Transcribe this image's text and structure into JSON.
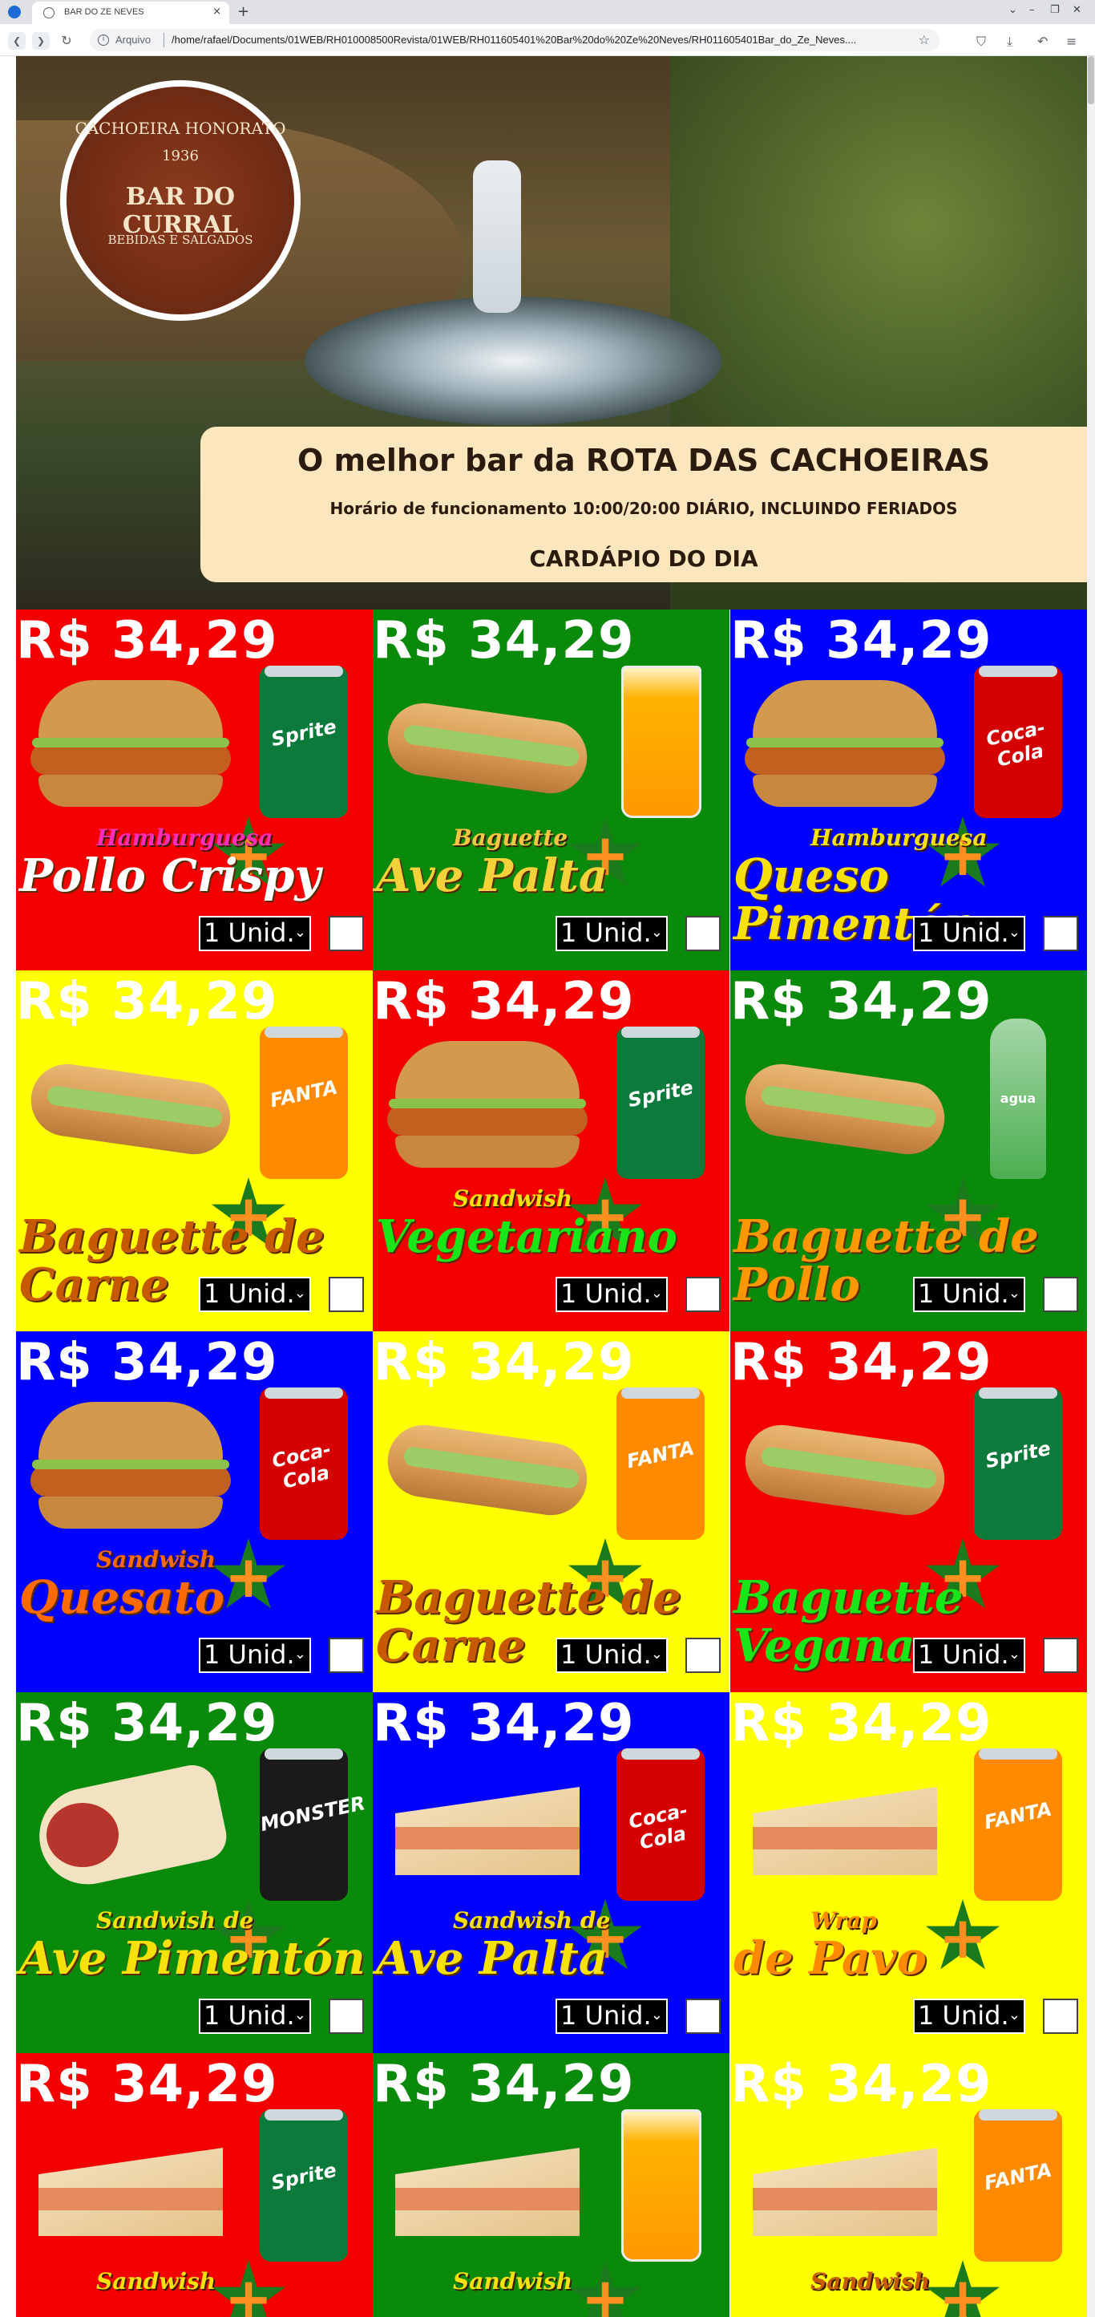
{
  "browser": {
    "tab_title": "BAR DO ZE NEVES",
    "tab_close": "×",
    "new_tab": "+",
    "scheme_label": "Arquivo",
    "url": "/home/rafael/Documents/01WEB/RH010008500Revista/01WEB/RH011605401%20Bar%20do%20Ze%20Neves/RH011605401Bar_do_Ze_Neves....",
    "window_min": "–",
    "window_max": "❐",
    "window_close": "✕"
  },
  "logo": {
    "line1": "CACHOEIRA HONORATO",
    "line2": "1936",
    "line3": "BAR DO CURRAL",
    "line4": "BEBIDAS E SALGADOS"
  },
  "banner": {
    "title": "O melhor bar da ROTA DAS CACHOEIRAS",
    "hours": "Horário de funcionamento 10:00/20:00 DIÁRIO, INCLUINDO FERIADOS",
    "menu_heading": "CARDÁPIO DO DIA"
  },
  "menu": {
    "price": "R$ 34,29",
    "plus_sign": "+",
    "qty_label": "1 Unid.",
    "qty_caret": "⌄",
    "items": [
      {
        "bg": "#f50000",
        "food": "burger",
        "drink": "can",
        "drink_color": "#0b7a3a",
        "drink_brand": "Sprite",
        "name1": "Hamburguesa",
        "name1_color": "#ff2db8",
        "name2": "Pollo Crispy",
        "name2_color": "#ffffff"
      },
      {
        "bg": "#0a8a0a",
        "food": "baguette",
        "drink": "glass",
        "drink_color": "#ff9800",
        "drink_brand": "",
        "name1": "Baguette",
        "name1_color": "#f7c744",
        "name2": "Ave Palta",
        "name2_color": "#f6d23a"
      },
      {
        "bg": "#0000ff",
        "food": "burger",
        "drink": "can",
        "drink_color": "#d50000",
        "drink_brand": "Coca-Cola",
        "name1": "Hamburguesa",
        "name1_color": "#f6e10a",
        "name2": "Queso Pimentón",
        "name2_color": "#f6e10a"
      },
      {
        "bg": "#ffff00",
        "food": "baguette",
        "drink": "can",
        "drink_color": "#ff8a00",
        "drink_brand": "FANTA",
        "name1": "",
        "name1_color": "#c75a00",
        "name2": "Baguette de Carne",
        "name2_color": "#c75a00"
      },
      {
        "bg": "#f50000",
        "food": "burger",
        "drink": "can",
        "drink_color": "#0b7a3a",
        "drink_brand": "Sprite",
        "name1": "Sandwish",
        "name1_color": "#f6e10a",
        "name2": "Vegetariano",
        "name2_color": "#19e619"
      },
      {
        "bg": "#0a8a0a",
        "food": "baguette",
        "drink": "bottle",
        "drink_color": "#4caf50",
        "drink_brand": "agua",
        "name1": "",
        "name1_color": "#ff9800",
        "name2": "Baguette de Pollo",
        "name2_color": "#ff9800"
      },
      {
        "bg": "#0000ff",
        "food": "burger",
        "drink": "can",
        "drink_color": "#d50000",
        "drink_brand": "Coca-Cola",
        "name1": "Sandwish",
        "name1_color": "#ff6a00",
        "name2": "Quesato",
        "name2_color": "#ff6a00"
      },
      {
        "bg": "#ffff00",
        "food": "baguette",
        "drink": "can",
        "drink_color": "#ff8a00",
        "drink_brand": "FANTA",
        "name1": "",
        "name1_color": "#c75a00",
        "name2": "Baguette de Carne",
        "name2_color": "#c75a00"
      },
      {
        "bg": "#f50000",
        "food": "baguette",
        "drink": "can",
        "drink_color": "#0b7a3a",
        "drink_brand": "Sprite",
        "name1": "",
        "name1_color": "#19e619",
        "name2": "Baguette Vegana",
        "name2_color": "#19e619"
      },
      {
        "bg": "#0a8a0a",
        "food": "wrap",
        "drink": "can",
        "drink_color": "#1a1a1a",
        "drink_brand": "MONSTER",
        "name1": "Sandwish de",
        "name1_color": "#f6e10a",
        "name2": "Ave Pimentón",
        "name2_color": "#f6e10a"
      },
      {
        "bg": "#0000ff",
        "food": "sandwich",
        "drink": "can",
        "drink_color": "#d50000",
        "drink_brand": "Coca-Cola",
        "name1": "Sandwish de",
        "name1_color": "#f6e10a",
        "name2": "Ave Palta",
        "name2_color": "#f6e10a"
      },
      {
        "bg": "#ffff00",
        "food": "sandwich",
        "drink": "can",
        "drink_color": "#ff8a00",
        "drink_brand": "FANTA",
        "name1": "Wrap",
        "name1_color": "#ff8a00",
        "name2": "de Pavo",
        "name2_color": "#ff8a00"
      },
      {
        "bg": "#f50000",
        "food": "sandwich",
        "drink": "can",
        "drink_color": "#0b7a3a",
        "drink_brand": "Sprite",
        "name1": "Sandwish",
        "name1_color": "#f6e10a",
        "name2": "",
        "name2_color": "#f6e10a"
      },
      {
        "bg": "#0a8a0a",
        "food": "sandwich",
        "drink": "glass",
        "drink_color": "#ff9800",
        "drink_brand": "",
        "name1": "Sandwish",
        "name1_color": "#f6e10a",
        "name2": "",
        "name2_color": "#f6e10a"
      },
      {
        "bg": "#ffff00",
        "food": "sandwich",
        "drink": "can",
        "drink_color": "#ff8a00",
        "drink_brand": "FANTA",
        "name1": "Sandwish",
        "name1_color": "#c75a00",
        "name2": "",
        "name2_color": "#c75a00"
      }
    ]
  }
}
